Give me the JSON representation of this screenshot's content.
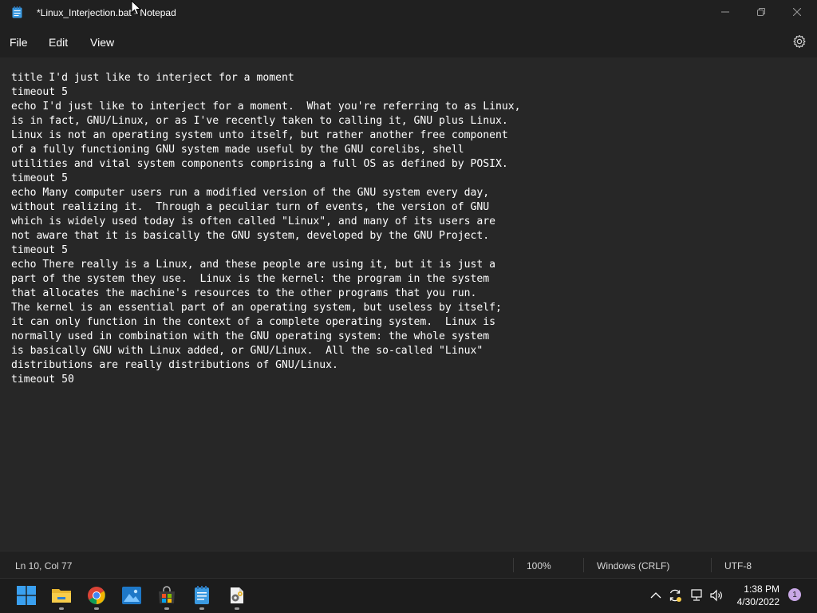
{
  "window": {
    "title": "*Linux_Interjection.bat - Notepad",
    "icon": "notepad-icon"
  },
  "menu": {
    "file": "File",
    "edit": "Edit",
    "view": "View",
    "settings_icon": "gear-icon"
  },
  "editor": {
    "lines": [
      "title I'd just like to interject for a moment",
      "timeout 5",
      "echo I'd just like to interject for a moment.  What you're referring to as Linux,",
      "is in fact, GNU/Linux, or as I've recently taken to calling it, GNU plus Linux.",
      "Linux is not an operating system unto itself, but rather another free component",
      "of a fully functioning GNU system made useful by the GNU corelibs, shell",
      "utilities and vital system components comprising a full OS as defined by POSIX.",
      "timeout 5",
      "echo Many computer users run a modified version of the GNU system every day,",
      "without realizing it.  Through a peculiar turn of events, the version of GNU",
      "which is widely used today is often called \"Linux\", and many of its users are",
      "not aware that it is basically the GNU system, developed by the GNU Project.",
      "timeout 5",
      "echo There really is a Linux, and these people are using it, but it is just a",
      "part of the system they use.  Linux is the kernel: the program in the system",
      "that allocates the machine's resources to the other programs that you run.",
      "The kernel is an essential part of an operating system, but useless by itself;",
      "it can only function in the context of a complete operating system.  Linux is",
      "normally used in combination with the GNU operating system: the whole system",
      "is basically GNU with Linux added, or GNU/Linux.  All the so-called \"Linux\"",
      "distributions are really distributions of GNU/Linux.",
      "timeout 50"
    ]
  },
  "status": {
    "position": "Ln 10, Col 77",
    "zoom": "100%",
    "line_ending": "Windows (CRLF)",
    "encoding": "UTF-8"
  },
  "taskbar": {
    "apps": [
      {
        "name": "start-button",
        "icon": "windows-logo-icon"
      },
      {
        "name": "file-explorer",
        "icon": "folder-icon"
      },
      {
        "name": "chrome",
        "icon": "chrome-icon"
      },
      {
        "name": "photos",
        "icon": "photos-icon"
      },
      {
        "name": "microsoft-store",
        "icon": "store-icon"
      },
      {
        "name": "notepad",
        "icon": "notepad-icon"
      },
      {
        "name": "batch-file",
        "icon": "batch-file-icon"
      }
    ],
    "tray": {
      "time": "1:38 PM",
      "date": "4/30/2022",
      "notifications": "1"
    }
  },
  "colors": {
    "background": "#202020",
    "editor_background": "#272727",
    "text": "#ffffff",
    "badge": "#c9a8e6"
  }
}
